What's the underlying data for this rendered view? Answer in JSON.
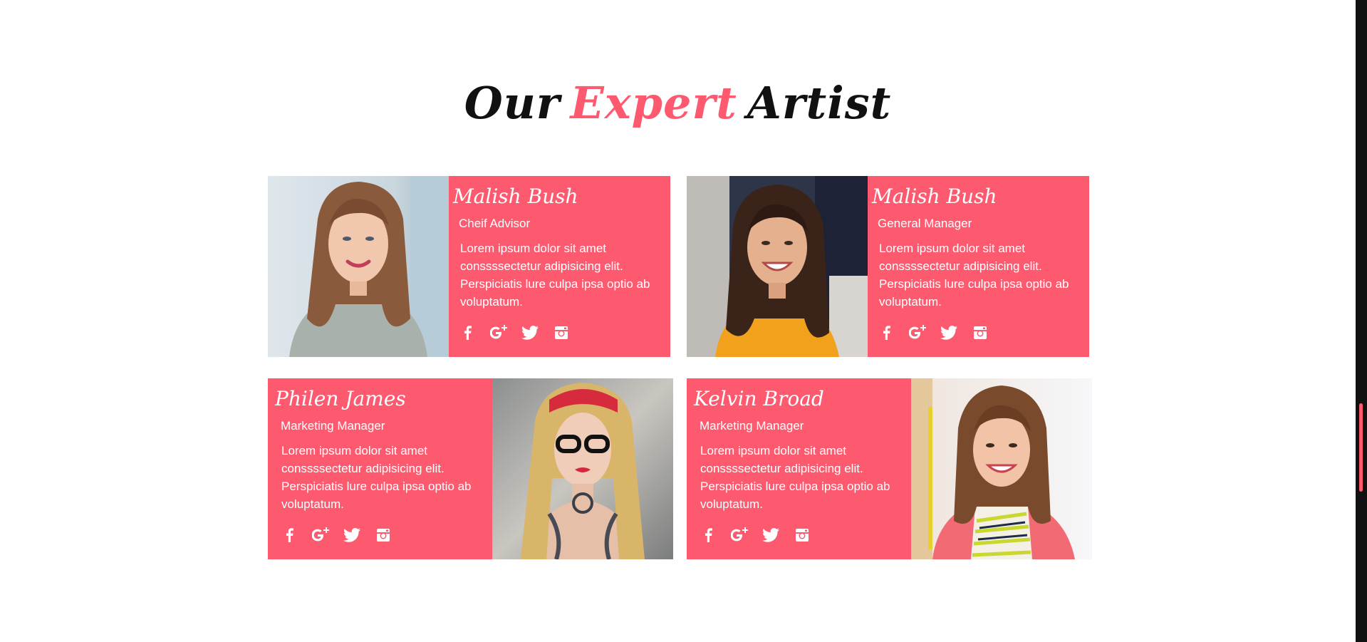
{
  "section": {
    "title_before": "Our",
    "title_accent": "Expert",
    "title_after": "Artist"
  },
  "artists": [
    {
      "name": "Malish Bush",
      "role": "Cheif Advisor",
      "bio": "Lorem ipsum dolor sit amet conssssectetur adipisicing elit. Perspiciatis lure culpa ipsa optio ab voluptatum."
    },
    {
      "name": "Malish Bush",
      "role": "General Manager",
      "bio": "Lorem ipsum dolor sit amet conssssectetur adipisicing elit. Perspiciatis lure culpa ipsa optio ab voluptatum."
    },
    {
      "name": "Philen James",
      "role": "Marketing Manager",
      "bio": "Lorem ipsum dolor sit amet conssssectetur adipisicing elit. Perspiciatis lure culpa ipsa optio ab voluptatum."
    },
    {
      "name": "Kelvin Broad",
      "role": "Marketing Manager",
      "bio": "Lorem ipsum dolor sit amet conssssectetur adipisicing elit. Perspiciatis lure culpa ipsa optio ab voluptatum."
    }
  ],
  "social_icons": [
    "facebook-icon",
    "google-plus-icon",
    "twitter-icon",
    "instagram-icon"
  ],
  "colors": {
    "accent": "#fd5a6f",
    "background": "#ffffff",
    "title": "#111111",
    "scrollbar_track": "#111111"
  }
}
